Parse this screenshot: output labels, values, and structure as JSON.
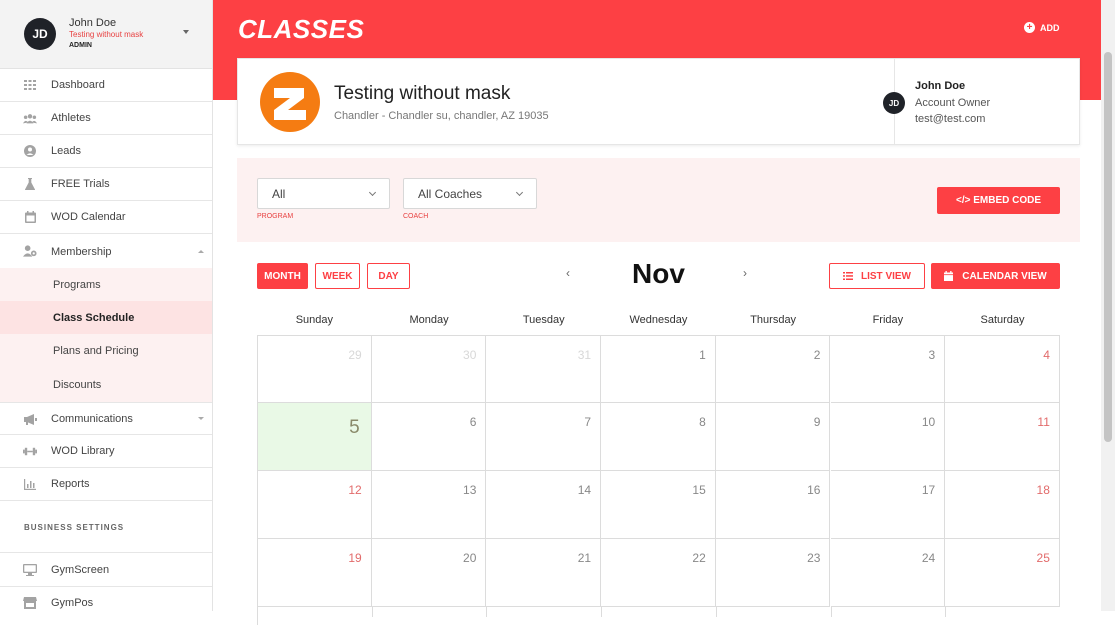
{
  "profile": {
    "initials": "JD",
    "name": "John Doe",
    "gym": "Testing without mask",
    "role": "ADMIN"
  },
  "sidebar": {
    "items": [
      {
        "label": "Dashboard",
        "icon": "grid-icon"
      },
      {
        "label": "Athletes",
        "icon": "users-icon"
      },
      {
        "label": "Leads",
        "icon": "user-circle-icon"
      },
      {
        "label": "FREE Trials",
        "icon": "flask-icon"
      },
      {
        "label": "WOD Calendar",
        "icon": "calendar-icon"
      },
      {
        "label": "Membership",
        "icon": "user-gear-icon"
      }
    ],
    "membership_sub": [
      {
        "label": "Programs"
      },
      {
        "label": "Class Schedule"
      },
      {
        "label": "Plans and Pricing"
      },
      {
        "label": "Discounts"
      }
    ],
    "items_after": [
      {
        "label": "Communications",
        "icon": "megaphone-icon"
      },
      {
        "label": "WOD Library",
        "icon": "dumbbell-icon"
      },
      {
        "label": "Reports",
        "icon": "chart-icon"
      }
    ],
    "section_title": "BUSINESS SETTINGS",
    "settings_items": [
      {
        "label": "GymScreen",
        "icon": "monitor-icon"
      },
      {
        "label": "GymPos",
        "icon": "store-icon"
      }
    ]
  },
  "header": {
    "title": "CLASSES",
    "add_label": "ADD",
    "brand_color": "#fd4044"
  },
  "gym_card": {
    "name": "Testing without mask",
    "address": "Chandler - Chandler su, chandler, AZ 19035",
    "owner_initials": "JD",
    "owner_name": "John Doe",
    "owner_role": "Account Owner",
    "owner_email": "test@test.com"
  },
  "filters": {
    "program_value": "All",
    "program_label": "PROGRAM",
    "coach_value": "All Coaches",
    "coach_label": "COACH",
    "embed_label": "</> EMBED CODE"
  },
  "calendar": {
    "view_buttons": [
      "MONTH",
      "WEEK",
      "DAY"
    ],
    "active_view": "MONTH",
    "month": "Nov",
    "prev": "‹",
    "next": "›",
    "list_view_label": "LIST VIEW",
    "calendar_view_label": "CALENDAR VIEW",
    "weekdays": [
      "Sunday",
      "Monday",
      "Tuesday",
      "Wednesday",
      "Thursday",
      "Friday",
      "Saturday"
    ],
    "weeks": [
      [
        "29",
        "30",
        "31",
        "1",
        "2",
        "3",
        "4"
      ],
      [
        "5",
        "6",
        "7",
        "8",
        "9",
        "10",
        "11"
      ],
      [
        "12",
        "13",
        "14",
        "15",
        "16",
        "17",
        "18"
      ],
      [
        "19",
        "20",
        "21",
        "22",
        "23",
        "24",
        "25"
      ]
    ],
    "today": "5"
  }
}
